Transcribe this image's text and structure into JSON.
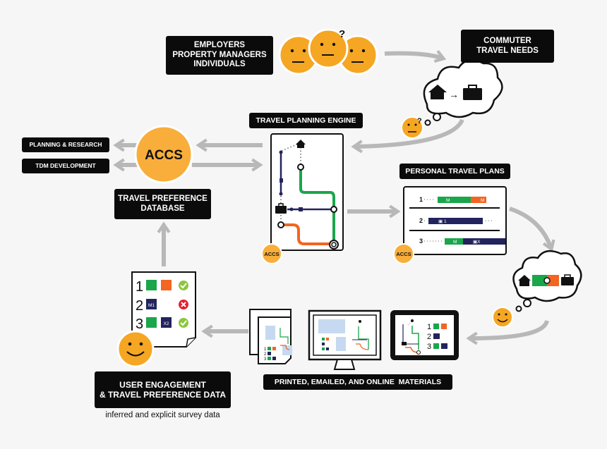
{
  "colors": {
    "background": "#f6f6f6",
    "label_bg": "#0b0b0b",
    "face": "#f5a623",
    "arrow": "#b8b8b8",
    "green": "#1aa64b",
    "orange": "#f26522",
    "navy": "#23235e",
    "check": "#8dc63f",
    "cross": "#e5202e",
    "placeholder": "#c6d9f0"
  },
  "labels": {
    "stakeholders": [
      "EMPLOYERS",
      "PROPERTY MANAGERS",
      "INDIVIDUALS"
    ],
    "commuter_needs": [
      "COMMUTER",
      "TRAVEL NEEDS"
    ],
    "planning_research": "PLANNING & RESEARCH",
    "tdm_development": "TDM DEVELOPMENT",
    "accs": "ACCS",
    "travel_pref_db": [
      "TRAVEL PREFERENCE",
      "DATABASE"
    ],
    "travel_planning_engine": "TRAVEL PLANNING ENGINE",
    "personal_travel_plans": "PERSONAL TRAVEL PLANS",
    "materials": "PRINTED, EMAILED, AND ONLINE  MATERIALS",
    "user_engagement": [
      "USER ENGAGEMENT",
      "& TRAVEL PREFERENCE DATA"
    ],
    "survey_note": "inferred and explicit survey data"
  },
  "travel_plans": [
    {
      "num": "1",
      "segments": [
        {
          "color": "green",
          "text": "M"
        },
        {
          "color": "orange",
          "text": "M"
        }
      ]
    },
    {
      "num": "2",
      "segments": [
        {
          "color": "navy",
          "text": "▣ 1"
        }
      ]
    },
    {
      "num": "3",
      "segments": [
        {
          "color": "green",
          "text": "M"
        },
        {
          "color": "navy",
          "text": "▣X"
        }
      ]
    }
  ],
  "survey_sheet": [
    {
      "num": "1",
      "chips": [
        {
          "color": "green",
          "text": ""
        },
        {
          "color": "orange",
          "text": ""
        }
      ],
      "status": "check"
    },
    {
      "num": "2",
      "chips": [
        {
          "color": "navy",
          "text": "M1"
        }
      ],
      "status": "cross"
    },
    {
      "num": "3",
      "chips": [
        {
          "color": "green",
          "text": ""
        },
        {
          "color": "navy",
          "text": "X2"
        }
      ],
      "status": "check"
    }
  ],
  "icons": {
    "question": "?",
    "arrow_right": "→"
  }
}
